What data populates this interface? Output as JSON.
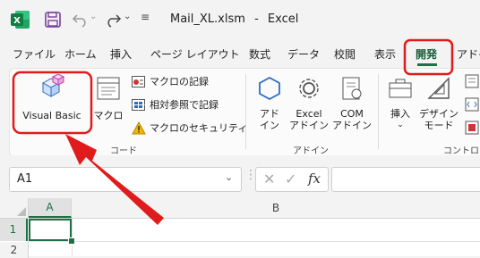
{
  "titlebar": {
    "filename": "Mail_XL.xlsm",
    "separator": "-",
    "app": "Excel",
    "icons": [
      "excel-logo-icon",
      "save-icon",
      "undo-icon",
      "redo-icon"
    ]
  },
  "ribbon_tabs": [
    "ファイル",
    "ホーム",
    "挿入",
    "ページ レイアウト",
    "数式",
    "データ",
    "校閲",
    "表示",
    "開発",
    "アドイ"
  ],
  "active_tab": "開発",
  "ribbon": {
    "code_group": {
      "visual_basic": "Visual Basic",
      "macro": "マクロ",
      "record_macro": "マクロの記録",
      "relative_ref": "相対参照で記録",
      "macro_security": "マクロのセキュリティ",
      "group_label": "コード"
    },
    "addin_group": {
      "addin_line1": "アド",
      "addin_line2": "イン",
      "excel_addin_line1": "Excel",
      "excel_addin_line2": "アドイン",
      "com_addin_line1": "COM",
      "com_addin_line2": "アドイン",
      "group_label": "アドイン"
    },
    "controls_group": {
      "insert": "挿入",
      "design_line1": "デザイン",
      "design_line2": "モード",
      "group_label": "コントロ…"
    }
  },
  "formula_bar": {
    "name_box": "A1",
    "fx": "fx"
  },
  "grid": {
    "col_a": "A",
    "col_b": "B",
    "row1": "1",
    "row2": "2"
  },
  "colors": {
    "excel_green": "#1e7145",
    "highlight_red": "#e01b1b"
  }
}
